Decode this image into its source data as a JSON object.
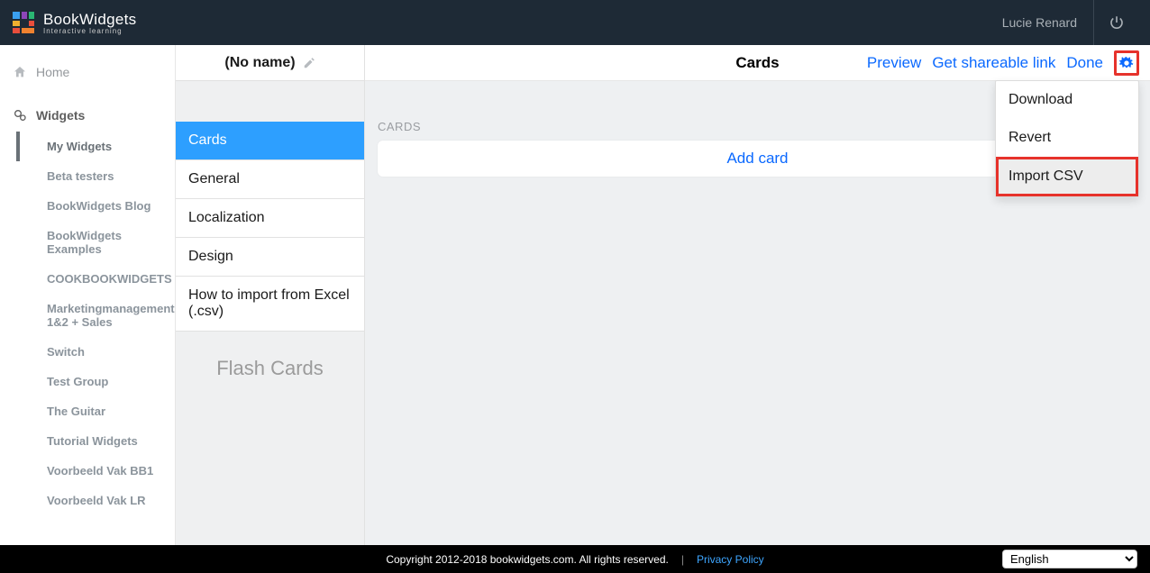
{
  "topbar": {
    "product": "BookWidgets",
    "tagline": "Interactive learning",
    "user": "Lucie Renard"
  },
  "leftnav": {
    "home": "Home",
    "widgets": "Widgets",
    "items": [
      "My Widgets",
      "Beta testers",
      "BookWidgets Blog",
      "BookWidgets Examples",
      "COOKBOOKWIDGETS",
      "Marketingmanagement 1&2 + Sales",
      "Switch",
      "Test Group",
      "The Guitar",
      "Tutorial Widgets",
      "Voorbeeld Vak BB1",
      "Voorbeeld Vak LR"
    ]
  },
  "center": {
    "title": "(No name)",
    "tabs": [
      "Cards",
      "General",
      "Localization",
      "Design",
      "How to import from Excel (.csv)"
    ],
    "widgetType": "Flash Cards"
  },
  "right": {
    "title": "Cards",
    "links": {
      "preview": "Preview",
      "share": "Get shareable link",
      "done": "Done"
    },
    "sectionLabel": "CARDS",
    "addCard": "Add card"
  },
  "dropdown": {
    "download": "Download",
    "revert": "Revert",
    "importCsv": "Import CSV"
  },
  "footer": {
    "copyright": "Copyright 2012-2018 bookwidgets.com. All rights reserved.",
    "privacy": "Privacy Policy",
    "language": "English"
  }
}
